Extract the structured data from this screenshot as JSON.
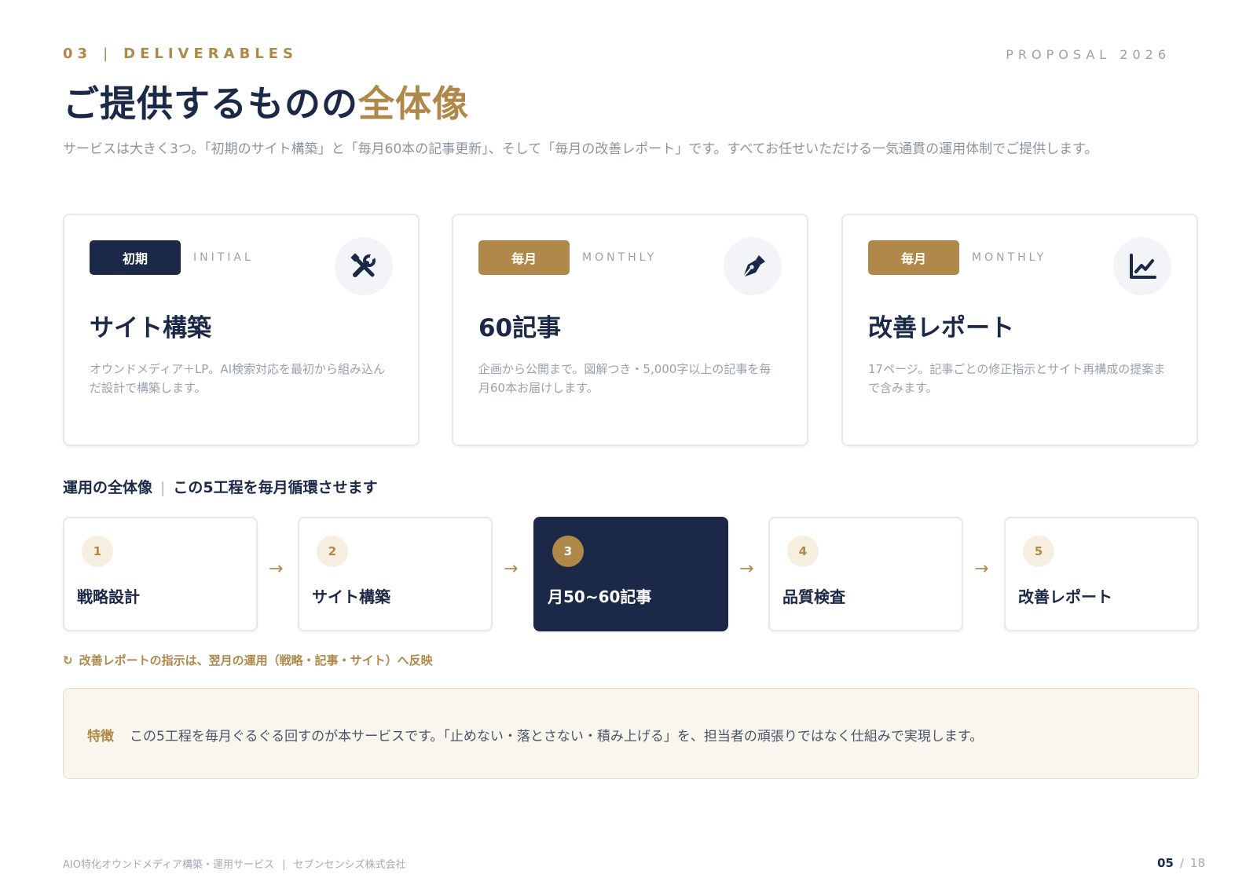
{
  "header": {
    "section_number": "03",
    "section_separator": "|",
    "section_label": "DELIVERABLES",
    "proposal": "PROPOSAL 2026",
    "title_main": "ご提供するものの",
    "title_accent": "全体像",
    "lead": "サービスは大きく3つ。「初期のサイト構築」と「毎月60本の記事更新」、そして「毎月の改善レポート」です。すべてお任せいただける一気通貫の運用体制でご提供します。"
  },
  "cards": [
    {
      "badge": "初期",
      "tag": "INITIAL",
      "icon": "tools-icon",
      "title": "サイト構築",
      "description": "オウンドメディア＋LP。AI検索対応を最初から組み込んだ設計で構築します。"
    },
    {
      "badge": "毎月",
      "tag": "MONTHLY",
      "icon": "pen-nib-icon",
      "title": "60記事",
      "description": "企画から公開まで。図解つき・5,000字以上の記事を毎月60本お届けします。"
    },
    {
      "badge": "毎月",
      "tag": "MONTHLY",
      "icon": "line-chart-icon",
      "title": "改善レポート",
      "description": "17ページ。記事ごとの修正指示とサイト再構成の提案まで含みます。"
    }
  ],
  "workflow": {
    "heading": "運用の全体像",
    "separator": "|",
    "subheading": "この5工程を毎月循環させます",
    "arrow": "→",
    "steps": [
      {
        "number": "1",
        "label": "戦略設計"
      },
      {
        "number": "2",
        "label": "サイト構築"
      },
      {
        "number": "3",
        "label": "月50~60記事"
      },
      {
        "number": "4",
        "label": "品質検査"
      },
      {
        "number": "5",
        "label": "改善レポート"
      }
    ],
    "loop_icon": "↻",
    "note": "改善レポートの指示は、翌月の運用（戦略・記事・サイト）へ反映"
  },
  "feature": {
    "label": "特徴",
    "text": "この5工程を毎月ぐるぐる回すのが本サービスです。「止めない・落とさない・積み上げる」を、担当者の頑張りではなく仕組みで実現します。"
  },
  "footer": {
    "service": "AIO特化オウンドメディア構築・運用サービス",
    "separator": "|",
    "company": "セブンセンシズ株式会社",
    "current_page": "05",
    "page_separator": "/",
    "total_pages": "18"
  },
  "colors": {
    "navy": "#1b2848",
    "gold": "#b0884a",
    "muted": "#9aa1ad",
    "feature_bg": "#f9f6ee"
  }
}
